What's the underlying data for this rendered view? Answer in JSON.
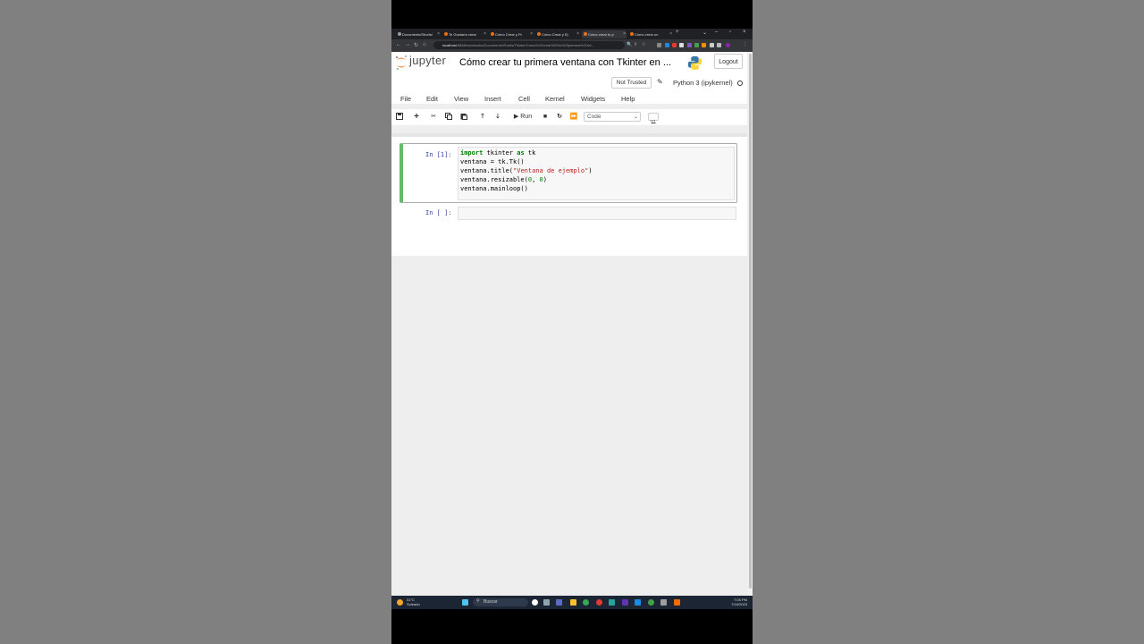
{
  "browser": {
    "tabs": [
      {
        "label": "Documents/Shorts/"
      },
      {
        "label": "Te Gustaría crear"
      },
      {
        "label": "Cómo Crear y Pr"
      },
      {
        "label": "Cómo Crear y Ej"
      },
      {
        "label": "Cómo crear tu p"
      },
      {
        "label": "Cómo crear un"
      }
    ],
    "new_tab": "+",
    "url_host": "localhost",
    "url_rest": ":8888/notebooks/Documents/Shorts/Tkinter/Como%20crear%20tu%20primera%20ve..."
  },
  "jupyter": {
    "logo_text": "jupyter",
    "notebook_title": "Cómo crear tu primera ventana con Tkinter en ...",
    "logout_label": "Logout",
    "trusted_label": "Not Trusted",
    "kernel_label": "Python 3 (ipykernel)",
    "menu": [
      "File",
      "Edit",
      "View",
      "Insert",
      "Cell",
      "Kernel",
      "Widgets",
      "Help"
    ],
    "run_label": "Run",
    "cell_type": "Code"
  },
  "cells": [
    {
      "prompt": "In [1]:",
      "lines": [
        "import tkinter as tk",
        "ventana = tk.Tk()",
        "ventana.title(\"Ventana de ejemplo\")",
        "ventana.resizable(0, 0)",
        "ventana.mainloop()"
      ]
    },
    {
      "prompt": "In [ ]:",
      "lines": []
    }
  ],
  "taskbar": {
    "weather_temp": "31°C",
    "weather_desc": "Soleado",
    "search_placeholder": "Buscar",
    "time": "7:05 PM",
    "date": "7/16/2023"
  },
  "colors": {
    "selected_cell_border": "#66bb6a",
    "prompt": "#303f9f",
    "keyword": "#008000",
    "string": "#ba2121"
  }
}
